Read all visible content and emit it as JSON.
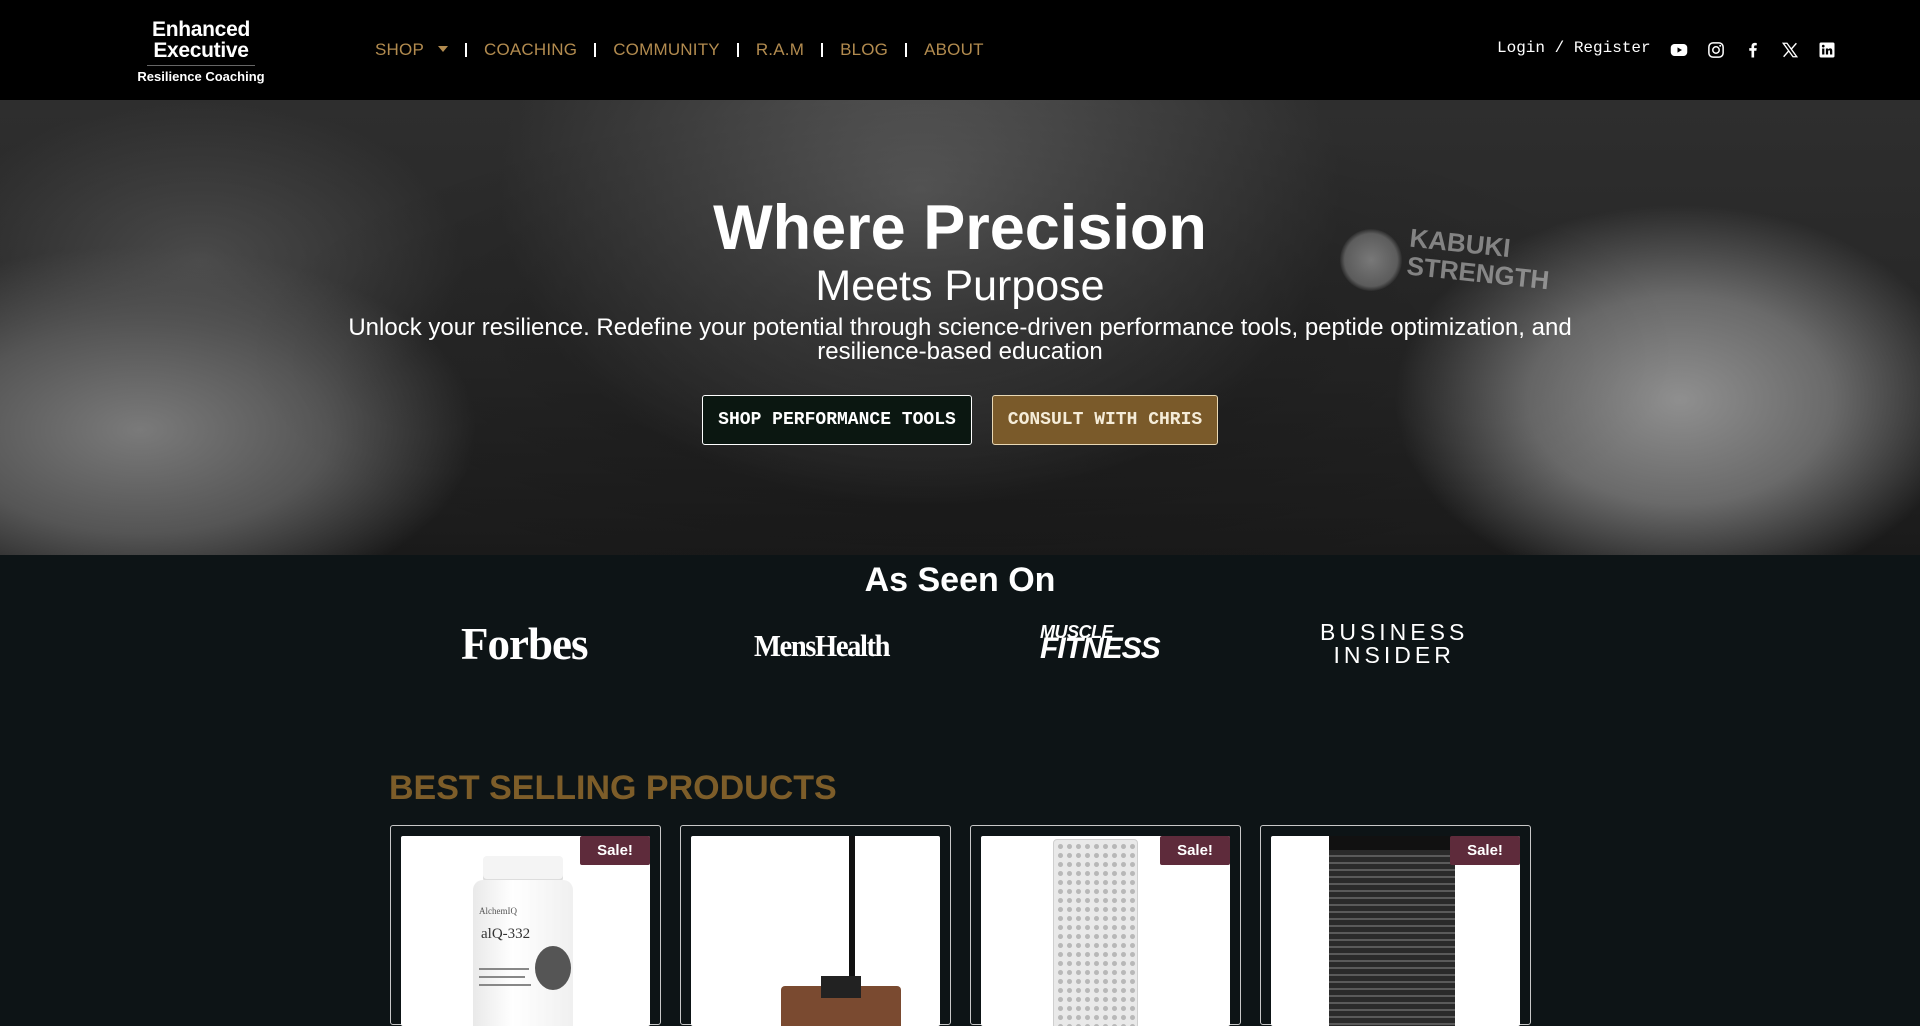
{
  "header": {
    "logo": {
      "line1": "Enhanced",
      "line2": "Executive",
      "tagline": "Resilience Coaching"
    },
    "nav": [
      {
        "label": "SHOP",
        "has_dropdown": true
      },
      {
        "label": "COACHING"
      },
      {
        "label": "COMMUNITY"
      },
      {
        "label": "R.A.M"
      },
      {
        "label": "BLOG"
      },
      {
        "label": "ABOUT"
      }
    ],
    "login_label": "Login / Register",
    "socials": [
      "youtube-icon",
      "instagram-icon",
      "facebook-icon",
      "x-icon",
      "linkedin-icon"
    ]
  },
  "hero": {
    "title": "Where Precision",
    "subtitle": "Meets Purpose",
    "description": "Unlock your resilience. Redefine your potential through science-driven performance tools, peptide optimization, and resilience-based education",
    "buttons": {
      "shop": "SHOP PERFORMANCE TOOLS",
      "consult": "CONSULT WITH CHRIS"
    },
    "background_brand": {
      "line1": "KABUKI",
      "line2": "STRENGTH"
    }
  },
  "as_seen_on": {
    "title": "As Seen On",
    "brands": {
      "forbes": "Forbes",
      "menshealth": "MensHealth",
      "muscle": "MUSCLE",
      "fitness": "FITNESS",
      "bi_line1": "BUSINESS",
      "bi_line2": "INSIDER"
    }
  },
  "products": {
    "title": "BEST SELLING PRODUCTS",
    "sale_label": "Sale!",
    "items": [
      {
        "sale": true,
        "brand": "AlchemIQ",
        "name": "alQ-332"
      },
      {
        "sale": false
      },
      {
        "sale": true
      },
      {
        "sale": true
      }
    ]
  },
  "colors": {
    "gold": "#b28b4f",
    "sale_badge": "#5e2b3b",
    "consult_button": "#7a5a2a",
    "products_title": "#7d5d29"
  }
}
